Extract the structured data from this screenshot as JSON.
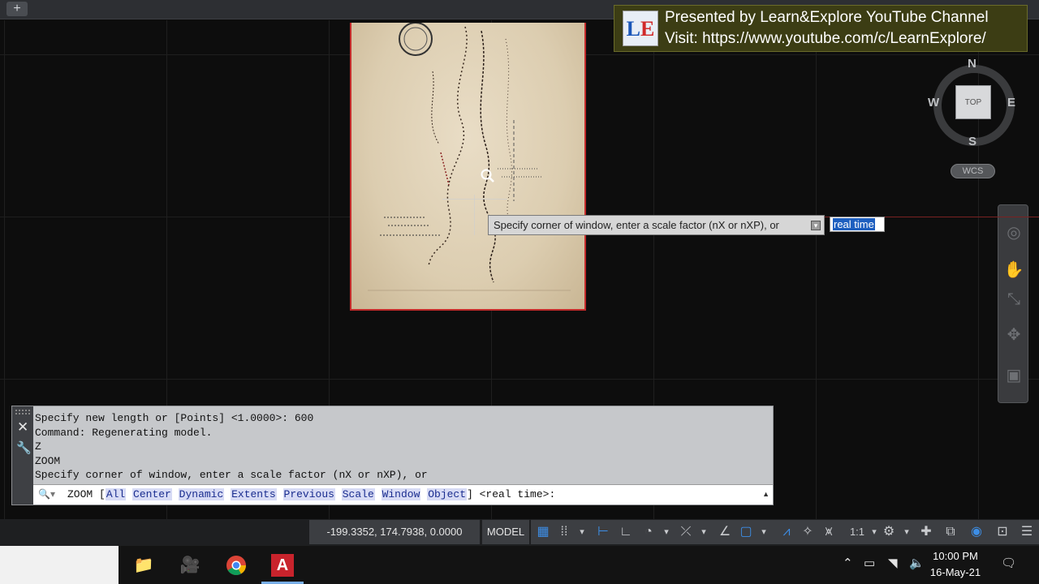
{
  "tabstrip": {
    "add_tab": "+"
  },
  "banner": {
    "logo_text": "LE",
    "line1": "Presented by Learn&Explore YouTube Channel",
    "line2": "Visit: https://www.youtube.com/c/LearnExplore/"
  },
  "viewcube": {
    "north": "N",
    "south": "S",
    "west": "W",
    "east": "E",
    "face": "TOP",
    "ucs": "WCS"
  },
  "dynamic_input": {
    "prompt": "Specify corner of window, enter a scale factor (nX or nXP), or",
    "value": "real time"
  },
  "command_line": {
    "history": [
      "Specify new length or [Points] <1.0000>: 600",
      "Command: Regenerating model.",
      "Z",
      "ZOOM",
      "Specify corner of window, enter a scale factor (nX or nXP), or"
    ],
    "command": "ZOOM",
    "options": [
      "All",
      "Center",
      "Dynamic",
      "Extents",
      "Previous",
      "Scale",
      "Window",
      "Object"
    ],
    "suffix": "<real time>:"
  },
  "statusbar": {
    "coordinates": "-199.3352, 174.7938, 0.0000",
    "space": "MODEL",
    "annotation_scale": "1:1"
  },
  "taskbar": {
    "apps": [
      {
        "name": "file-explorer",
        "icon": "folder-icon"
      },
      {
        "name": "video-recorder",
        "icon": "camera-icon"
      },
      {
        "name": "chrome",
        "icon": "chrome-icon"
      },
      {
        "name": "autocad",
        "icon": "autocad-icon",
        "active": true
      }
    ],
    "time": "10:00 PM",
    "date": "16-May-21"
  },
  "colors": {
    "accent": "#3d8ee6",
    "canvas": "#0d0d0d",
    "command_bg": "#c6c8cb",
    "option_highlight": "#d7dbf5",
    "map_border": "#c42b2b"
  }
}
